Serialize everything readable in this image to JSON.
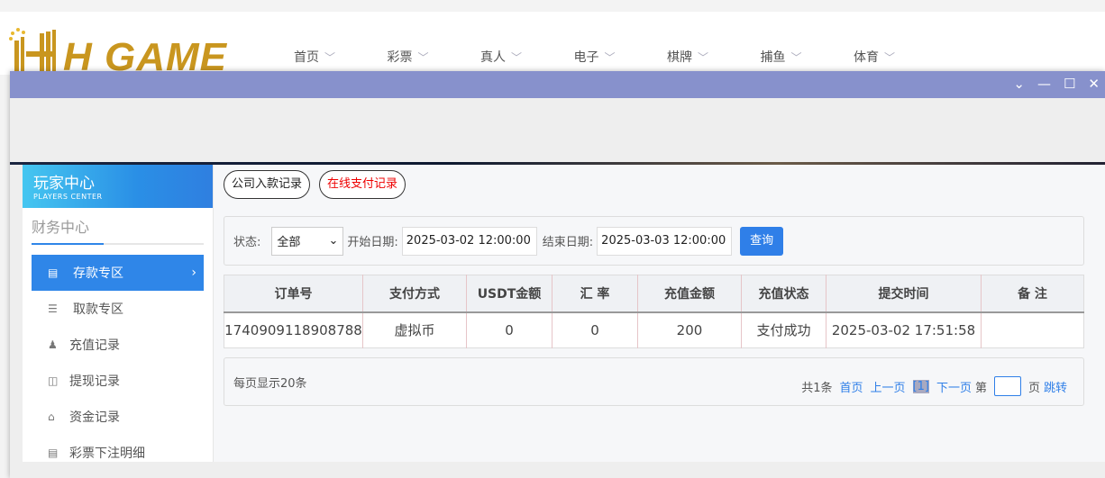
{
  "logo": {
    "text": "H GAME"
  },
  "nav": [
    "首页",
    "彩票",
    "真人",
    "电子",
    "棋牌",
    "捕鱼",
    "体育"
  ],
  "window_controls": [
    "chevron-down",
    "minimize",
    "maximize",
    "close"
  ],
  "sidebar": {
    "title": "玩家中心",
    "subtitle": "PLAYERS CENTER",
    "section": "财务中心",
    "items": [
      {
        "label": "存款专区",
        "icon": "card-icon",
        "active": true
      },
      {
        "label": "取款专区",
        "icon": "hand-money-icon"
      },
      {
        "label": "充值记录",
        "icon": "money-bag-icon"
      },
      {
        "label": "提现记录",
        "icon": "wallet-icon"
      },
      {
        "label": "资金记录",
        "icon": "piggy-icon"
      },
      {
        "label": "彩票下注明细",
        "icon": "list-icon"
      }
    ]
  },
  "tabs": [
    {
      "label": "公司入款记录"
    },
    {
      "label": "在线支付记录",
      "color": "#ee0000"
    }
  ],
  "filter": {
    "status_label": "状态:",
    "status_value": "全部",
    "start_label": "开始日期:",
    "start_value": "2025-03-02 12:00:00",
    "end_label": "结束日期:",
    "end_value": "2025-03-03 12:00:00",
    "query": "查询"
  },
  "table": {
    "headers": [
      "订单号",
      "支付方式",
      "USDT金额",
      "汇 率",
      "充值金额",
      "充值状态",
      "提交时间",
      "备 注"
    ],
    "rows": [
      [
        "1740909118908788",
        "虚拟币",
        "0",
        "0",
        "200",
        "支付成功",
        "2025-03-02 17:51:58",
        ""
      ]
    ]
  },
  "pager": {
    "per_page": "每页显示20条",
    "total": "共1条",
    "first": "首页",
    "prev": "上一页",
    "current": "[1]",
    "next": "下一页",
    "page_prefix": "第",
    "page_suffix": "页",
    "jump": "跳转"
  },
  "colors": {
    "accent": "#2f86e8",
    "titlebar": "#8791cc"
  }
}
